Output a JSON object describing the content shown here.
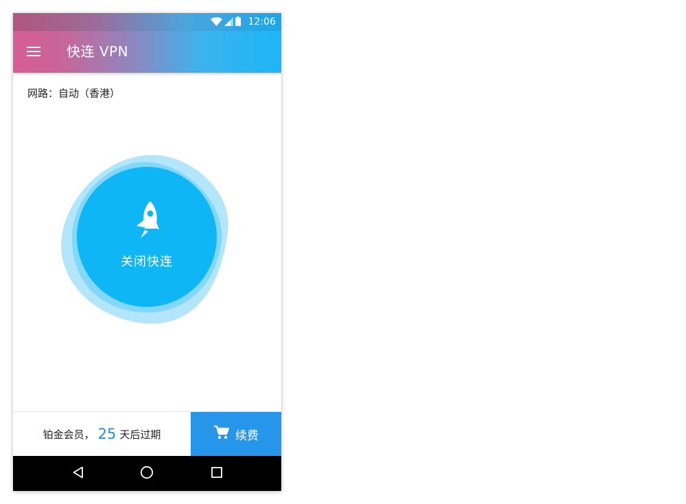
{
  "status_bar": {
    "time": "12:06",
    "icons": [
      "wifi-icon",
      "signal-icon",
      "battery-icon"
    ]
  },
  "app_bar": {
    "menu_icon": "menu-icon",
    "title": "快连 VPN"
  },
  "route": {
    "label": "网路：自动（香港）"
  },
  "connect": {
    "icon": "rocket-icon",
    "label": "关闭快连"
  },
  "membership": {
    "prefix": "铂金会员，",
    "days": "25",
    "suffix": "天后过期"
  },
  "renew": {
    "icon": "cart-icon",
    "label": "续费"
  },
  "nav": {
    "items": [
      "back-icon",
      "home-icon",
      "recents-icon"
    ]
  },
  "colors": {
    "accent": "#0fb6f6",
    "renew": "#2596ea",
    "days": "#1f8be8",
    "halo": "#b3e6fb"
  }
}
